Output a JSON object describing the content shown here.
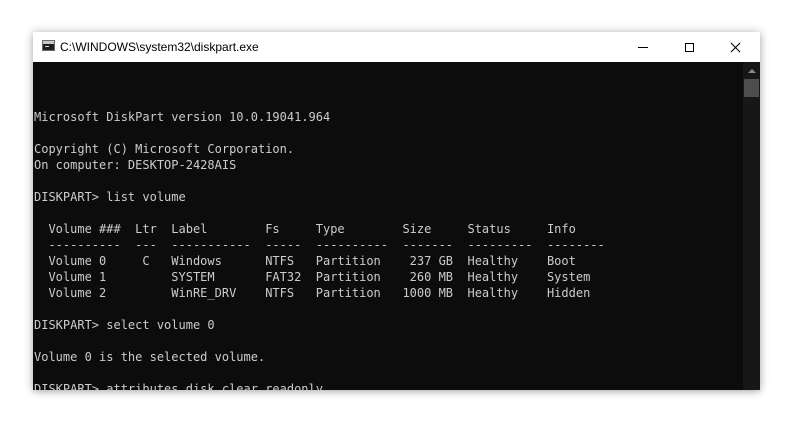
{
  "window": {
    "title": "C:\\WINDOWS\\system32\\diskpart.exe",
    "icon": "console-app-icon"
  },
  "controls": {
    "minimize": "minimize-icon",
    "maximize": "maximize-icon",
    "close": "close-icon"
  },
  "console": {
    "lines": [
      "",
      "Microsoft DiskPart version 10.0.19041.964",
      "",
      "Copyright (C) Microsoft Corporation.",
      "On computer: DESKTOP-2428AIS",
      "",
      "DISKPART> list volume",
      "",
      "  Volume ###  Ltr  Label        Fs     Type        Size     Status     Info",
      "  ----------  ---  -----------  -----  ----------  -------  ---------  --------",
      "  Volume 0     C   Windows      NTFS   Partition    237 GB  Healthy    Boot",
      "  Volume 1         SYSTEM       FAT32  Partition    260 MB  Healthy    System",
      "  Volume 2         WinRE_DRV    NTFS   Partition   1000 MB  Healthy    Hidden",
      "",
      "DISKPART> select volume 0",
      "",
      "Volume 0 is the selected volume.",
      "",
      "DISKPART> attributes disk clear readonly"
    ]
  },
  "colors": {
    "console_background": "#0c0c0c",
    "console_text": "#cccccc",
    "titlebar": "#ffffff"
  }
}
